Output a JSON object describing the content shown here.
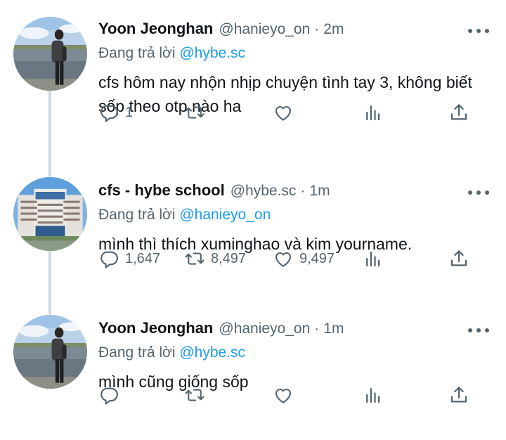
{
  "tweets": [
    {
      "name": "Yoon Jeonghan",
      "handle": "@hanieyo_on",
      "time": "2m",
      "reply_prefix": "Đang trả lời",
      "reply_mention": "@hybe.sc",
      "text": "cfs hôm nay nhộn nhịp chuyện tình tay 3, không biết sốp theo otp nào ha",
      "replies": "1",
      "retweets": "",
      "likes": "",
      "avatar_icon": "person-by-river-photo"
    },
    {
      "name": "cfs - hybe school",
      "handle": "@hybe.sc",
      "time": "1m",
      "reply_prefix": "Đang trả lời",
      "reply_mention": "@hanieyo_on",
      "text": "mình thì thích xuminghao và kim yourname.",
      "replies": "1,647",
      "retweets": "8,497",
      "likes": "9,497",
      "avatar_icon": "school-building-photo"
    },
    {
      "name": "Yoon Jeonghan",
      "handle": "@hanieyo_on",
      "time": "1m",
      "reply_prefix": "Đang trả lời",
      "reply_mention": "@hybe.sc",
      "text": "mình cũng giống sốp",
      "replies": "",
      "retweets": "",
      "likes": "",
      "avatar_icon": "person-by-river-photo"
    }
  ],
  "colors": {
    "text": "#0f1419",
    "secondary": "#536471",
    "link": "#1d9bf0",
    "thread_line": "#cfd9de"
  },
  "icons": [
    "reply-icon",
    "retweet-icon",
    "like-icon",
    "views-icon",
    "share-icon",
    "more-icon"
  ]
}
